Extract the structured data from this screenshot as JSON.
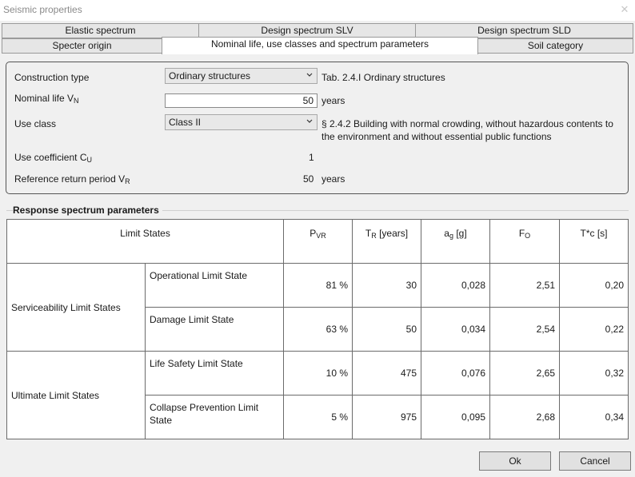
{
  "window": {
    "title": "Seismic properties"
  },
  "tabs": {
    "row1": [
      "Elastic spectrum",
      "Design spectrum SLV",
      "Design spectrum SLD"
    ],
    "row2": [
      "Specter origin",
      "Nominal life, use classes and spectrum parameters",
      "Soil category"
    ]
  },
  "form": {
    "construction_type_label": "Construction type",
    "construction_type_value": "Ordinary structures",
    "construction_type_note": "Tab. 2.4.I Ordinary structures",
    "nominal_life_label": "Nominal life V",
    "nominal_life_label_sub": "N",
    "nominal_life_value": "50",
    "nominal_life_unit": "years",
    "use_class_label": "Use class",
    "use_class_value": "Class II",
    "use_class_note_line1": "§ 2.4.2 Building with normal crowding, without hazardous contents to",
    "use_class_note_line2": "the environment and without essential public functions",
    "use_coeff_label": "Use coefficient C",
    "use_coeff_label_sub": "U",
    "use_coeff_value": "1",
    "return_period_label": "Reference return period V",
    "return_period_label_sub": "R",
    "return_period_value": "50",
    "return_period_unit": "years"
  },
  "response": {
    "section_title": "Response spectrum parameters",
    "headers": {
      "limit_states": "Limit States",
      "pvr_main": "P",
      "pvr_sub": "VR",
      "tr_main": "T",
      "tr_sub": "R",
      "tr_rest": " [years]",
      "ag_main": "a",
      "ag_sub": "g",
      "ag_rest": " [g]",
      "fo_main": "F",
      "fo_sub": "O",
      "tc": "T*c [s]"
    },
    "groups": [
      "Serviceability Limit States",
      "Ultimate Limit States"
    ],
    "rows": [
      {
        "state": "Operational Limit State",
        "pvr": "81 %",
        "tr": "30",
        "ag": "0,028",
        "fo": "2,51",
        "tc": "0,20"
      },
      {
        "state": "Damage Limit State",
        "pvr": "63 %",
        "tr": "50",
        "ag": "0,034",
        "fo": "2,54",
        "tc": "0,22"
      },
      {
        "state": "Life Safety Limit State",
        "pvr": "10 %",
        "tr": "475",
        "ag": "0,076",
        "fo": "2,65",
        "tc": "0,32"
      },
      {
        "state": "Collapse Prevention Limit State",
        "pvr": "5 %",
        "tr": "975",
        "ag": "0,095",
        "fo": "2,68",
        "tc": "0,34"
      }
    ]
  },
  "buttons": {
    "ok": "Ok",
    "cancel": "Cancel"
  }
}
